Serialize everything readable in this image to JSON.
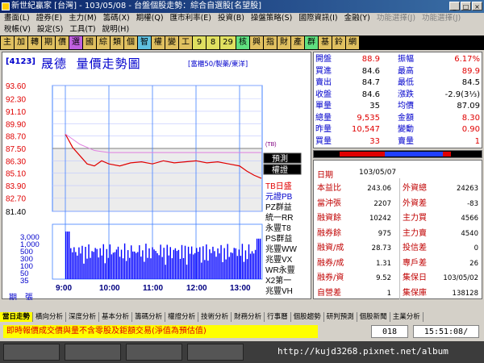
{
  "window": {
    "title": "新世紀贏家 [台灣] - 103/05/08 - 台盤個股走勢：綜合自選股[名望股]",
    "buttons": [
      "_",
      "□",
      "×"
    ]
  },
  "menu": {
    "row1": [
      "畫面(L)",
      "證券(E)",
      "主力(M)",
      "籌碼(X)",
      "期權(Q)",
      "匯市利率(E)",
      "投資(B)",
      "操盤策略(S)",
      "國際資訊(I)",
      "金融(Y)",
      "功能選擇(J)",
      "功能選擇(J)"
    ],
    "row2": [
      "稅帳(V)",
      "設定(S)",
      "工具(T)",
      "說明(H)"
    ]
  },
  "toolbar": [
    "主",
    "加",
    "轉",
    "期",
    "價",
    "選",
    "國",
    "綜",
    "類",
    "個",
    "智",
    "權",
    "變",
    "工",
    "9",
    "8",
    "29",
    "核",
    "興",
    "指",
    "財",
    "產",
    "群",
    "基",
    "鈴",
    "網"
  ],
  "chart": {
    "code": "[4123]",
    "name": "晟德",
    "title": "量價走勢圖",
    "subtitle": "[富櫃50/製藥/東洋]",
    "price_ticks": [
      "93.60",
      "92.30",
      "91.10",
      "89.90",
      "88.70",
      "87.50",
      "86.30",
      "85.10",
      "83.90",
      "82.70",
      "81.40"
    ],
    "volume_ticks": [
      "3,000",
      "1,000",
      "500",
      "300",
      "100",
      "50",
      "35"
    ],
    "volume_label": "期　張",
    "x_ticks": [
      "9:00",
      "10:00",
      "11:00",
      "12:00",
      "13:00"
    ],
    "side_buttons": [
      "預測",
      "權證"
    ],
    "side_labels": [
      "(TB)",
      "TB日盛",
      "元證PB",
      "PZ群益",
      "統一RR",
      "永豐T8",
      "PS群益",
      "兆豐WW",
      "兆豐VX",
      "WR永豐",
      "X2第一",
      "兆豐VH",
      "....."
    ]
  },
  "chart_data": {
    "type": "line",
    "x": [
      "09:00",
      "09:10",
      "09:20",
      "09:30",
      "09:40",
      "09:50",
      "10:00",
      "10:15",
      "10:30",
      "10:45",
      "11:00",
      "11:15",
      "11:30",
      "11:45",
      "12:00",
      "12:15",
      "12:30",
      "12:45",
      "13:00",
      "13:10",
      "13:20",
      "13:30"
    ],
    "series": [
      {
        "values": [
          88.9,
          87.6,
          86.8,
          86.0,
          85.8,
          86.3,
          86.0,
          85.8,
          86.1,
          86.2,
          86.0,
          86.3,
          86.1,
          86.2,
          86.3,
          86.1,
          86.2,
          86.0,
          85.8,
          85.3,
          84.9,
          84.6
        ]
      },
      {
        "values": [
          88.9,
          88.4,
          87.9,
          87.6,
          87.3,
          87.2,
          87.1,
          87.1,
          87.1,
          87.1,
          87.1,
          87.1,
          87.1,
          87.1,
          87.1,
          87.1,
          87.1,
          87.1,
          87.1,
          87.1,
          87.1,
          87.1
        ]
      }
    ],
    "reference": 87.5,
    "ylim": [
      81.4,
      93.6
    ],
    "volume_ylim": [
      0,
      3000
    ],
    "volume": [
      2600,
      700,
      450,
      300,
      250,
      200,
      420,
      180,
      150,
      120,
      100,
      120,
      90,
      100,
      80,
      90,
      110,
      150,
      160,
      250,
      320,
      900
    ]
  },
  "quote": {
    "rows": [
      [
        "開盤",
        "88.9",
        "振幅",
        "6.17%"
      ],
      [
        "買進",
        "84.6",
        "最高",
        "89.9"
      ],
      [
        "賣出",
        "84.7",
        "最低",
        "84.5"
      ],
      [
        "收盤",
        "84.6",
        "漲跌",
        "-2.9(3⅓)"
      ],
      [
        "單量",
        "35",
        "均價",
        "87.09"
      ],
      [
        "總量",
        "9,535",
        "金額",
        "8.30"
      ],
      [
        "昨量",
        "10,547",
        "變動",
        "0.90"
      ],
      [
        "買量",
        "33",
        "賣量",
        "1"
      ]
    ]
  },
  "info": {
    "date_label": "日期",
    "date": "103/05/07",
    "rows": [
      [
        "本益比",
        "243.06",
        "外資總",
        "24263"
      ],
      [
        "當沖張",
        "2207",
        "外資差",
        "-83"
      ],
      [
        "融資餘",
        "10242",
        "主力買",
        "4566"
      ],
      [
        "融券餘",
        "975",
        "主力賣",
        "4540"
      ],
      [
        "融資/成",
        "28.73",
        "投信差",
        "0"
      ],
      [
        "融券/成",
        "1.31",
        "專戶差",
        "26"
      ],
      [
        "融券/資",
        "9.52",
        "集保日",
        "103/05/02"
      ],
      [
        "自營差",
        "1",
        "集保庫",
        "138128"
      ]
    ]
  },
  "tabs": [
    "當日走勢",
    "橫向分析",
    "深度分析",
    "基本分析",
    "籌碼分析",
    "權證分析",
    "技術分析",
    "財務分析",
    "行事曆",
    "個股趨勢",
    "研判預測",
    "個股新聞",
    "主業分析"
  ],
  "status": {
    "message": "即時報價成交價與量不含零股及鉅額交易(淨值為預估值)",
    "count": "018",
    "time": "15:51:08/"
  },
  "taskbar": {
    "url": "http://kujd3268.pixnet.net/album"
  }
}
